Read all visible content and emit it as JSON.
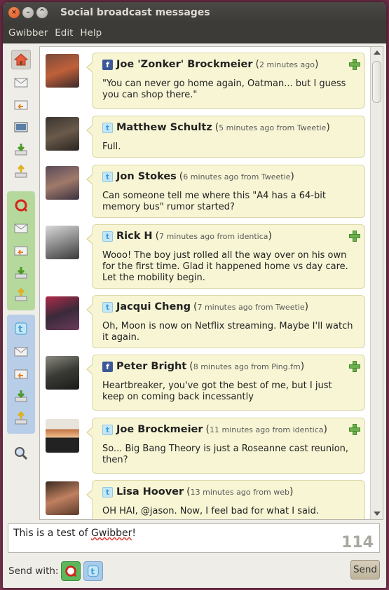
{
  "window": {
    "title": "Social broadcast messages"
  },
  "menu": [
    "Gwibber",
    "Edit",
    "Help"
  ],
  "sidebar": {
    "groups": [
      {
        "accent": "none",
        "icons": [
          "home-icon",
          "envelope-icon",
          "reply-icon",
          "image-icon",
          "download-icon",
          "upload-icon"
        ]
      },
      {
        "accent": "#b5d99c",
        "service": "identica",
        "icons": [
          "identica-icon",
          "envelope-icon",
          "reply-icon",
          "download-icon",
          "upload-icon"
        ]
      },
      {
        "accent": "#b7cde8",
        "service": "twitter",
        "icons": [
          "twitter-icon",
          "envelope-icon",
          "reply-icon",
          "download-icon",
          "upload-icon"
        ]
      }
    ],
    "search_icon": "magnifier-icon"
  },
  "messages": [
    {
      "name": "Joe 'Zonker' Brockmeier",
      "meta": "2 minutes ago",
      "service": "facebook",
      "text": "\"You can never go home again, Oatman... but I guess you can shop there.\"",
      "has_plus": true
    },
    {
      "name": "Matthew Schultz",
      "meta": "5 minutes ago from Tweetie",
      "service": "twitter",
      "text": "Full.",
      "has_plus": false
    },
    {
      "name": "Jon Stokes",
      "meta": "6 minutes ago from Tweetie",
      "service": "twitter",
      "text": "Can someone tell me where this \"A4 has a 64-bit memory bus\" rumor started?",
      "has_plus": false
    },
    {
      "name": "Rick H",
      "meta": "7 minutes ago from identica",
      "service": "twitter",
      "text": "Wooo! The boy just rolled all the way over on his own for the first time. Glad it happened home vs day care. Let the mobility begin.",
      "has_plus": true
    },
    {
      "name": "Jacqui Cheng",
      "meta": "7 minutes ago from Tweetie",
      "service": "twitter",
      "text": "Oh, Moon is now on Netflix streaming. Maybe I'll watch it again.",
      "has_plus": false
    },
    {
      "name": "Peter Bright",
      "meta": "8 minutes ago from Ping.fm",
      "service": "facebook",
      "text": "Heartbreaker, you've got the best of me, but I just keep on coming back incessantly",
      "has_plus": true
    },
    {
      "name": "Joe Brockmeier",
      "meta": "11 minutes ago from identica",
      "service": "twitter",
      "text": "So... Big Bang Theory is just a Roseanne cast reunion, then?",
      "has_plus": true
    },
    {
      "name": "Lisa Hoover",
      "meta": "13 minutes ago from web",
      "service": "twitter",
      "text": "OH HAI, @jason. Now, I feel bad for what I said.",
      "has_plus": false
    }
  ],
  "composer": {
    "text": "This is a test of ",
    "text_misspelled": "Gwibber",
    "text_end": "!",
    "count": "114"
  },
  "send": {
    "label": "Send with:",
    "button": "Send",
    "services": [
      "identica-icon",
      "twitter-icon"
    ]
  },
  "colors": {
    "bubble": "#f7f5d4",
    "facebook": "#3b5998",
    "twitter": "#3aa0d8",
    "identica": "#5bb85a"
  }
}
